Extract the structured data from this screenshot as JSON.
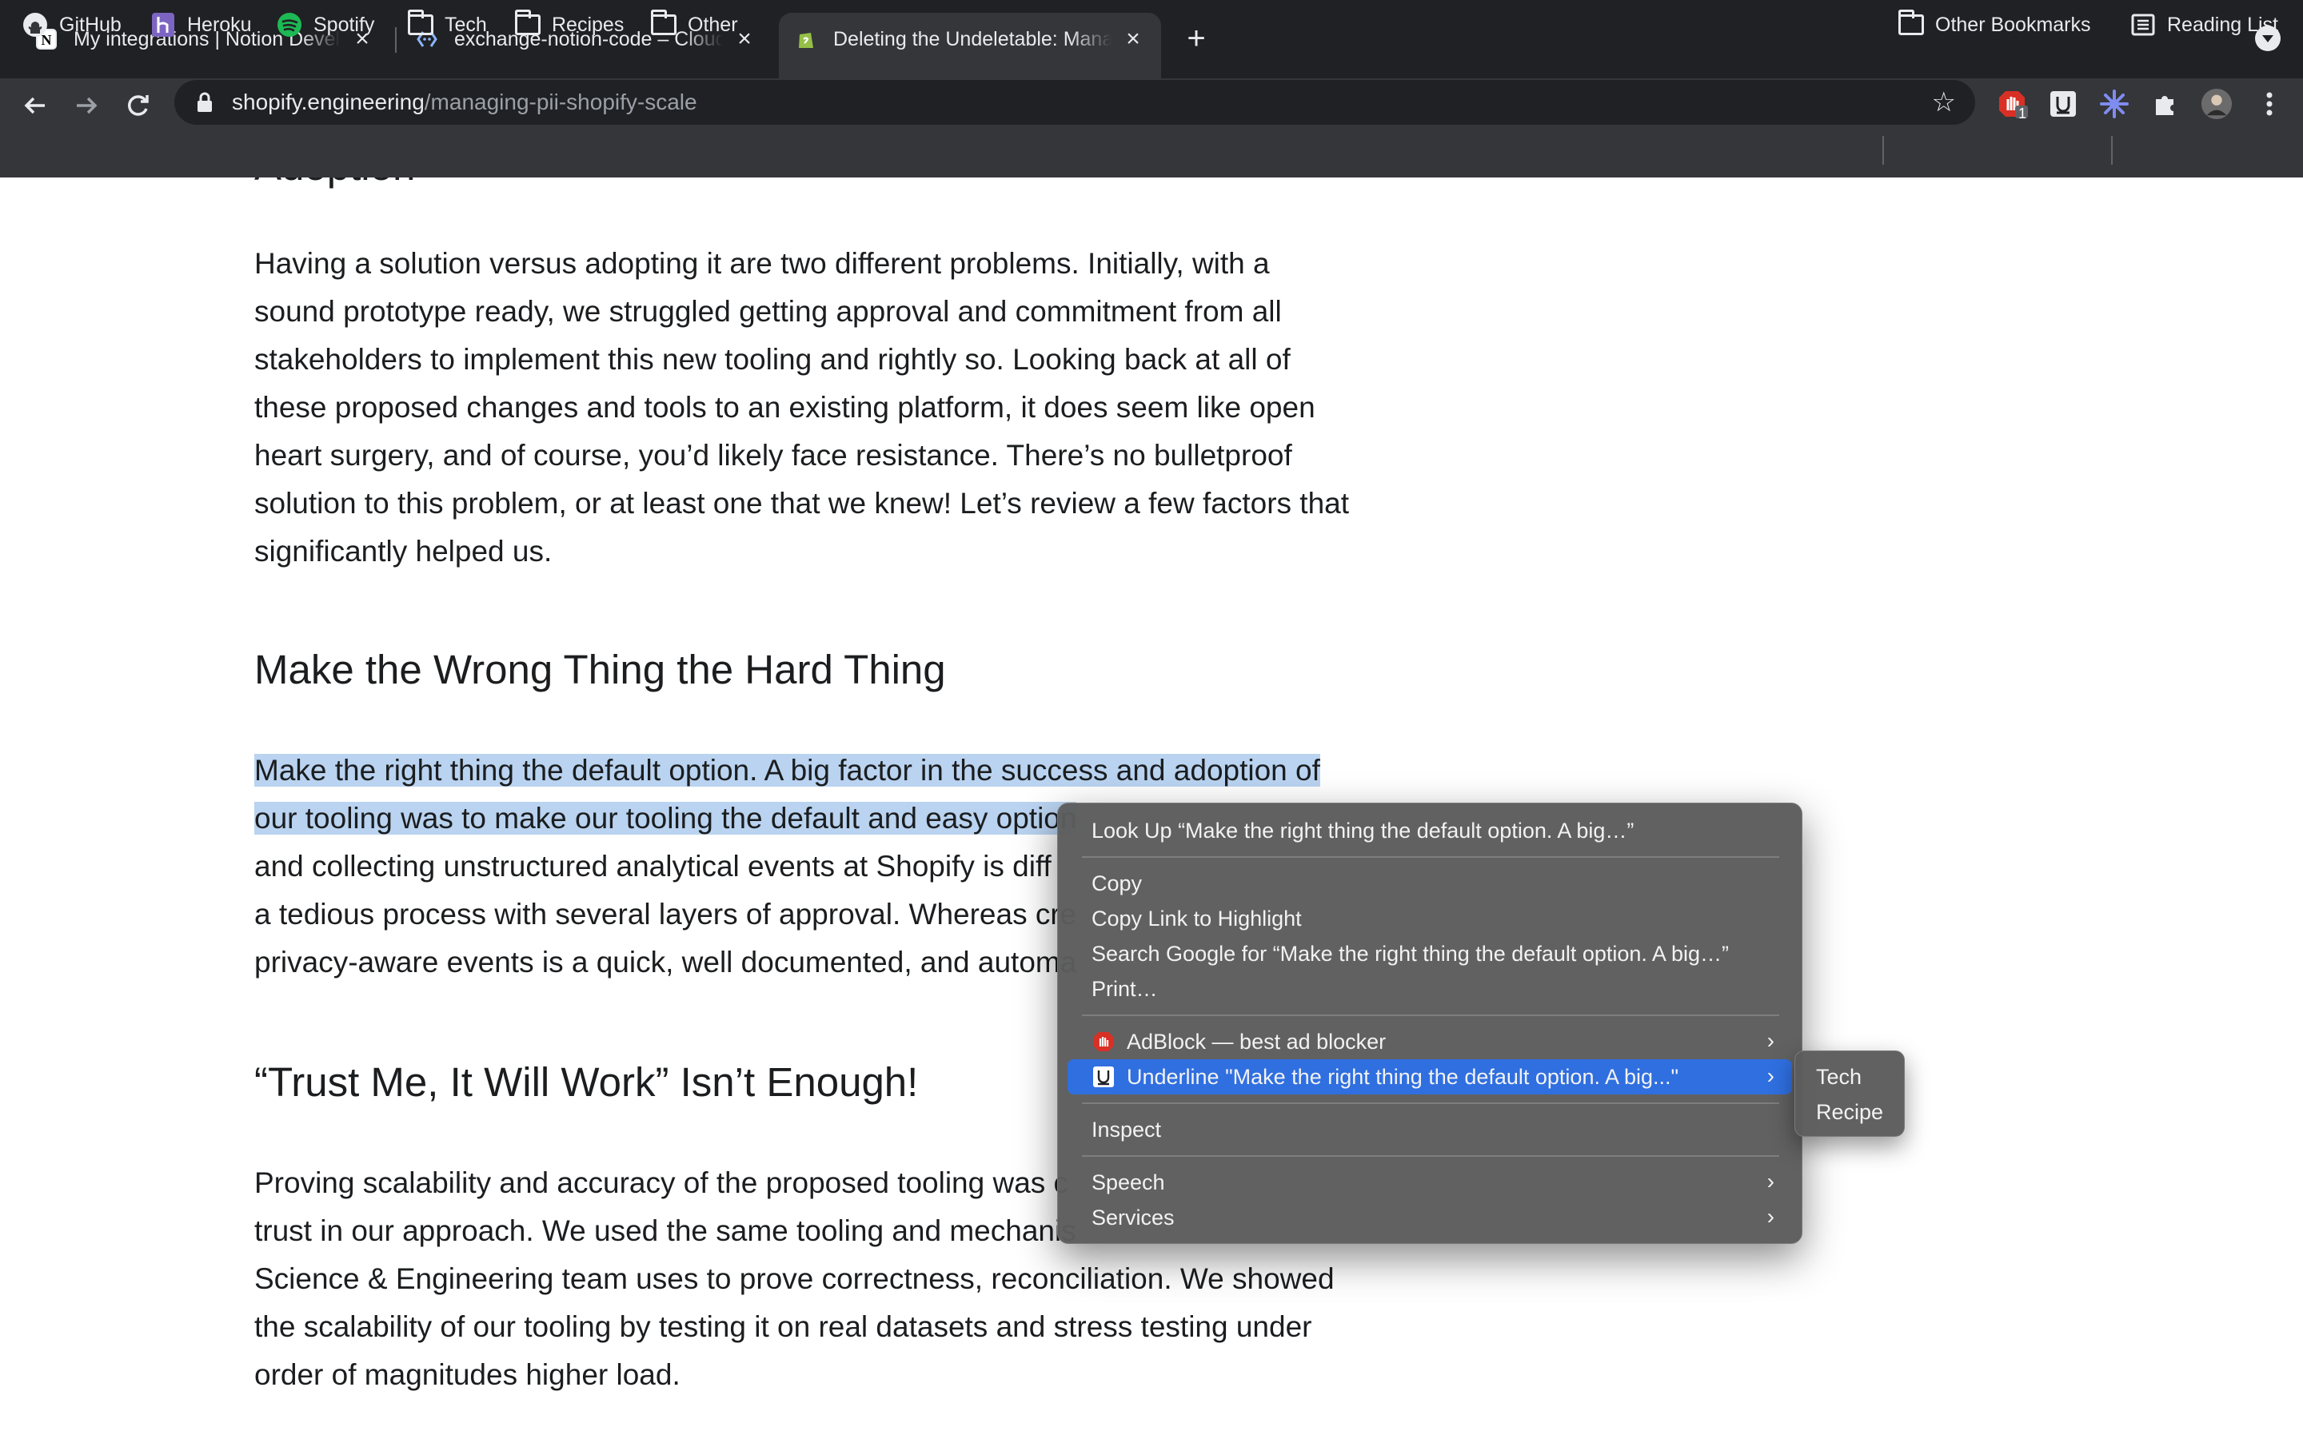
{
  "tabs": [
    {
      "title": "My integrations | Notion Developers",
      "icon": "notion-icon"
    },
    {
      "title": "exchange-notion-code – Cloudflare",
      "icon": "cloudflare-workers-icon"
    },
    {
      "title": "Deleting the Undeletable: Managing PII at Shopify Scale",
      "icon": "shopify-icon"
    }
  ],
  "address_bar": {
    "host": "shopify.engineering",
    "path": "/managing-pii-shopify-scale"
  },
  "extensions": {
    "adblock_badge": "1"
  },
  "bookmarks": [
    "GitHub",
    "Heroku",
    "Spotify",
    "Tech",
    "Recipes",
    "Other"
  ],
  "bookmarks_right": [
    "Other Bookmarks",
    "Reading List"
  ],
  "article": {
    "partial_heading": "Adoption",
    "para1": [
      "Having a solution versus adopting it are two different problems. Initially, with a",
      "sound prototype ready, we struggled getting approval and commitment from all",
      "stakeholders to implement this new tooling and rightly so. Looking back at all of",
      "these proposed changes and tools to an existing platform, it does seem like open",
      "heart surgery, and of course, you’d likely face resistance. There’s no bulletproof",
      "solution to this problem, or at least one that we knew! Let’s review a few factors that",
      "significantly helped us."
    ],
    "heading1": "Make the Wrong Thing the Hard Thing",
    "para2": [
      "Make the right thing the default option. A big factor in the success and adoption of",
      "our tooling was to make our tooling the default and easy option",
      "and collecting unstructured analytical events at Shopify is diff",
      "a tedious process with several layers of approval. Whereas cre",
      "privacy-aware events is a quick, well documented, and automa"
    ],
    "heading2": "“Trust Me, It Will Work” Isn’t Enough!",
    "para3": [
      "Proving scalability and accuracy of the proposed tooling was c",
      "trust in our approach. We used the same tooling and mechanis",
      "Science & Engineering team uses to prove correctness, reconciliation. We showed",
      "the scalability of our tooling by testing it on real datasets and stress testing under",
      "order of magnitudes higher load."
    ]
  },
  "context_menu": {
    "look_up": "Look Up “Make the right thing the default option. A big…”",
    "copy": "Copy",
    "copy_link": "Copy Link to Highlight",
    "search_google": "Search Google for “Make the right thing the default option. A big…”",
    "print": "Print…",
    "adblock": "AdBlock — best ad blocker",
    "underline": "Underline \"Make the right thing the default option. A big...\"",
    "inspect": "Inspect",
    "speech": "Speech",
    "services": "Services"
  },
  "submenu": [
    "Tech",
    "Recipe"
  ],
  "colors": {
    "selection": "#b9d3f0",
    "menu_highlight": "#2f6fe0",
    "chrome_dark": "#202124",
    "chrome": "#35363a"
  }
}
